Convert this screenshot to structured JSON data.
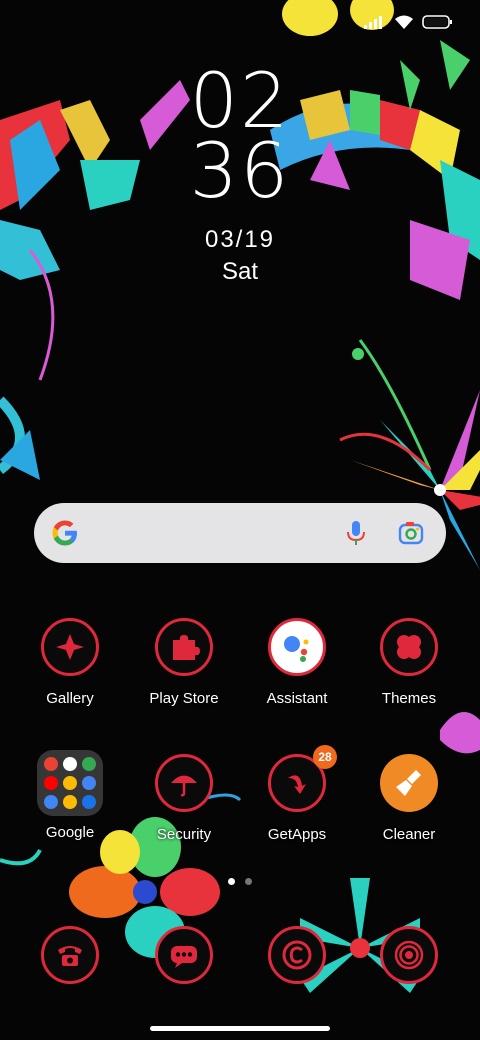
{
  "status": {
    "signal_icon": "signal-icon",
    "wifi_icon": "wifi-icon",
    "battery_icon": "battery-icon"
  },
  "clock": {
    "hours": "02",
    "minutes": "36",
    "date": "03/19",
    "day": "Sat"
  },
  "search": {
    "logo_icon": "google-g-icon",
    "mic_icon": "mic-icon",
    "lens_icon": "lens-icon"
  },
  "apps": {
    "row1": [
      {
        "label": "Gallery"
      },
      {
        "label": "Play Store"
      },
      {
        "label": "Assistant"
      },
      {
        "label": "Themes"
      }
    ],
    "row2": [
      {
        "label": "Google"
      },
      {
        "label": "Security"
      },
      {
        "label": "GetApps",
        "badge": "28"
      },
      {
        "label": "Cleaner"
      }
    ],
    "dock": [
      {
        "icon": "phone-icon"
      },
      {
        "icon": "messages-icon"
      },
      {
        "icon": "browser-icon"
      },
      {
        "icon": "camera-icon"
      }
    ]
  },
  "pager": {
    "pages": 2,
    "current": 1
  },
  "colors": {
    "accent_red": "#e0283c",
    "badge_orange": "#f06a1e",
    "cleaner_orange": "#f08a24"
  }
}
